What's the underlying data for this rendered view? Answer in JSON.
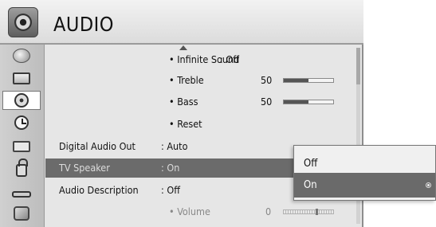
{
  "header": {
    "title": "AUDIO",
    "icon": "speaker-icon"
  },
  "sidebar": {
    "items": [
      {
        "name": "picture",
        "icon": "picture-icon"
      },
      {
        "name": "screen",
        "icon": "monitor-icon"
      },
      {
        "name": "audio",
        "icon": "speaker-icon",
        "selected": true
      },
      {
        "name": "time",
        "icon": "clock-icon"
      },
      {
        "name": "option",
        "icon": "briefcase-icon"
      },
      {
        "name": "lock",
        "icon": "lock-icon"
      },
      {
        "name": "input",
        "icon": "plug-icon"
      },
      {
        "name": "support",
        "icon": "globe-icon"
      }
    ]
  },
  "menu": {
    "infinite_sound": {
      "label": "• Infinite Sound",
      "value": ": Off"
    },
    "treble": {
      "label": "• Treble",
      "value": "50",
      "level": 0.5
    },
    "bass": {
      "label": "• Bass",
      "value": "50",
      "level": 0.5
    },
    "reset": {
      "label": "• Reset"
    },
    "digital_audio_out": {
      "label": "Digital Audio Out",
      "value": ": Auto"
    },
    "tv_speaker": {
      "label": "TV Speaker",
      "value": ": On"
    },
    "audio_description": {
      "label": "Audio Description",
      "value": ": Off"
    },
    "volume": {
      "label": "• Volume",
      "value": "0",
      "level": 0.0
    }
  },
  "popup": {
    "options": [
      {
        "label": "Off",
        "selected": false
      },
      {
        "label": "On",
        "selected": true
      }
    ]
  },
  "colors": {
    "background": "#e6e6e6",
    "highlight": "#6b6b6b",
    "popup_selected": "#6a6a6a"
  }
}
